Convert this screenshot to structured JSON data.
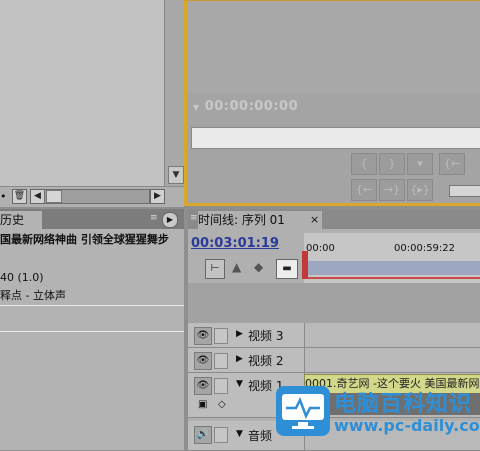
{
  "project_panel": {
    "trash_icon": "trash-icon",
    "left_arrow": "◀",
    "right_arrow": "▶",
    "down_arrow": "▼"
  },
  "monitor_panel": {
    "timecode": "00:00:00:00"
  },
  "history_panel": {
    "tab_label": "历史",
    "lines": [
      "国最新网络神曲 引领全球猩猩舞步",
      "40 (1.0)",
      "释点 - 立体声"
    ]
  },
  "timeline_panel": {
    "tab_label": "时间线: 序列 01",
    "close": "×",
    "timecode": "00:03:01:19",
    "ruler_labels": [
      "00:00",
      "00:00:59:22"
    ],
    "tracks": [
      {
        "name": "视频 3"
      },
      {
        "name": "视频 2"
      },
      {
        "name": "视频 1",
        "clip": "0001.奇艺网 -这个要火 美国最新网"
      },
      {
        "name": "音频"
      }
    ]
  },
  "watermark": {
    "title": "电脑百科知识",
    "url": "www.pc-daily.com"
  },
  "colors": {
    "panel_highlight": "#d9a62e",
    "timecode_link": "#2a3a9a",
    "clip_fill": "#d2d78a",
    "brand_blue": "#2f8fd6"
  }
}
